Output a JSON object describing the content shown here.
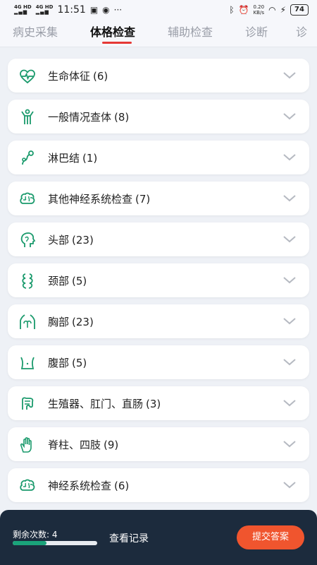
{
  "status_bar": {
    "net1": "4G HD",
    "net2": "4G HD",
    "time": "11:51",
    "speed_top": "0.20",
    "speed_bottom": "KB/s",
    "battery": "74"
  },
  "tabs": [
    {
      "label": "病史采集",
      "active": false
    },
    {
      "label": "体格检查",
      "active": true
    },
    {
      "label": "辅助检查",
      "active": false
    },
    {
      "label": "诊断",
      "active": false
    },
    {
      "label": "诊",
      "active": false
    }
  ],
  "sections": [
    {
      "name": "生命体征",
      "count": "(6)",
      "icon": "heart-pulse-icon"
    },
    {
      "name": "一般情况查体",
      "count": "(8)",
      "icon": "person-body-icon"
    },
    {
      "name": "淋巴结",
      "count": "(1)",
      "icon": "lymph-node-icon"
    },
    {
      "name": "其他神经系统检查",
      "count": "(7)",
      "icon": "brain-icon"
    },
    {
      "name": "头部",
      "count": "(23)",
      "icon": "head-icon"
    },
    {
      "name": "颈部",
      "count": "(5)",
      "icon": "neck-icon"
    },
    {
      "name": "胸部",
      "count": "(23)",
      "icon": "chest-icon"
    },
    {
      "name": "腹部",
      "count": "(5)",
      "icon": "abdomen-icon"
    },
    {
      "name": "生殖器、肛门、直肠",
      "count": "(3)",
      "icon": "intestine-icon"
    },
    {
      "name": "脊柱、四肢",
      "count": "(9)",
      "icon": "hand-icon"
    },
    {
      "name": "神经系统检查",
      "count": "(6)",
      "icon": "brain-icon"
    }
  ],
  "bottom": {
    "remaining_label": "剩余次数: 4",
    "remaining_fraction": 0.4,
    "view_records": "查看记录",
    "submit": "提交答案"
  },
  "colors": {
    "accent": "#e53935",
    "icon_green": "#1a9a6c",
    "bottom_bg": "#1c2b3d",
    "submit_bg": "#f0552e"
  }
}
